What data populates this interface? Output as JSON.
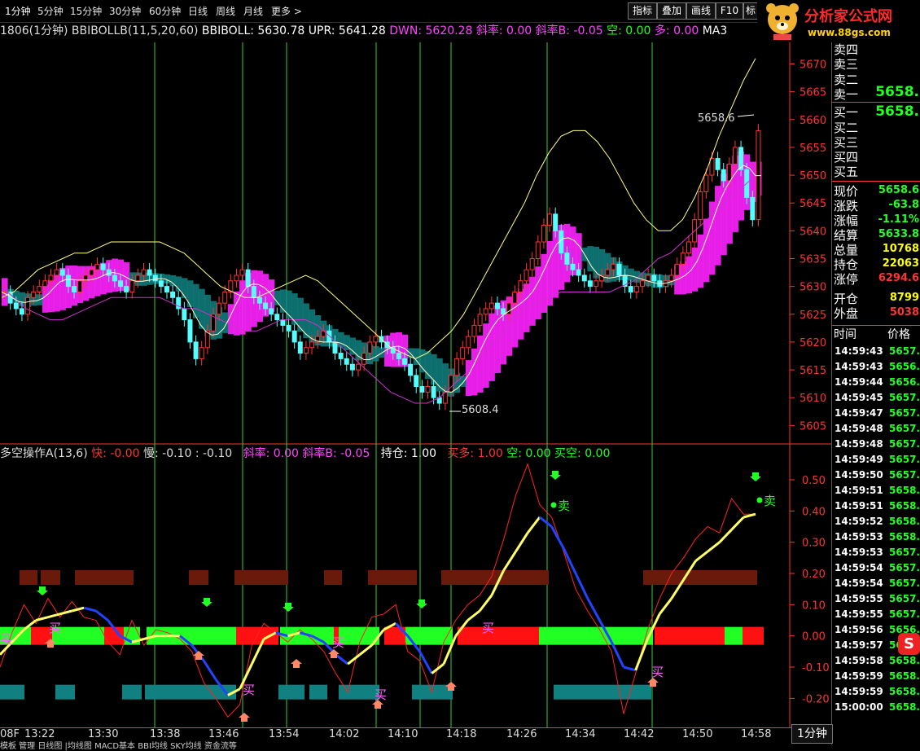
{
  "toolbar": {
    "periods": [
      "1分钟",
      "5分钟",
      "15分钟",
      "30分钟",
      "60分钟",
      "日线",
      "周线",
      "月线",
      "更多 >"
    ],
    "right_buttons": [
      "指标",
      "叠加",
      "画线",
      "F10",
      "标"
    ]
  },
  "logo": {
    "title": "分析家公式网",
    "url": "www.88gs.com"
  },
  "main_header": {
    "symbol": "1806(1分钟)",
    "indicator": "BBIBOLLB(11,5,20,60)",
    "bbiboll": "BBIBOLL: 5630.78",
    "upr": "UPR: 5641.28",
    "dwn": "DWN: 5620.28",
    "slope": "斜率: 0.00",
    "slope_b": "斜率B: -0.05",
    "kong": "空: 0.00",
    "duo": "多: 0.00",
    "ma": "MA3"
  },
  "sub_header": {
    "name": "多空操作A(13,6)",
    "fast": "快: -0.00",
    "slow": "慢: -0.10",
    "diff": ": -0.10",
    "slope": "斜率: 0.00",
    "slope_b": "斜率B: -0.05",
    "hold": "持仓: 1.00",
    "buy_long": "买多: 1.00",
    "kong": "空: 0.00",
    "buy_short": "买空: 0.00"
  },
  "price_axis": [
    "5670",
    "5665",
    "5660",
    "5655",
    "5650",
    "5645",
    "5640",
    "5635",
    "5630",
    "5625",
    "5620",
    "5615",
    "5610",
    "5605"
  ],
  "osc_axis": [
    "0.50",
    "0.40",
    "0.30",
    "0.20",
    "0.10",
    "0.00",
    "-0.10",
    "-0.20"
  ],
  "time_axis": [
    "08F",
    "13:22",
    "13:30",
    "13:38",
    "13:46",
    "13:54",
    "14:02",
    "14:10",
    "14:18",
    "14:26",
    "14:34",
    "14:42",
    "14:50",
    "14:58"
  ],
  "timeframe_button": "1分钟",
  "bottom_tabs": "模板 管理 日线图 |均线图 MACD基本 BBI均线 SKY均线 资金流等",
  "annotations": {
    "high": "5658.6",
    "low": "5608.4",
    "sell": "卖",
    "buy": "买"
  },
  "quote_panel": {
    "asks": [
      "卖四",
      "卖三",
      "卖二",
      "卖一"
    ],
    "ask1_price": "5658.",
    "bids": [
      "买一",
      "买二",
      "买三",
      "买四",
      "买五"
    ],
    "bid1_price": "5658.",
    "stats": [
      {
        "label": "现价",
        "value": "5658.6",
        "color": "#22ff22"
      },
      {
        "label": "涨跌",
        "value": "-63.8",
        "color": "#22ff22"
      },
      {
        "label": "涨幅",
        "value": "-1.11%",
        "color": "#22ff22"
      },
      {
        "label": "结算",
        "value": "5633.8",
        "color": "#22ff22"
      },
      {
        "label": "总量",
        "value": "10768",
        "color": "#ffff00"
      },
      {
        "label": "持仓",
        "value": "22063",
        "color": "#ffff00"
      },
      {
        "label": "涨停",
        "value": "6294.6",
        "color": "#ff3333"
      },
      {
        "label": "开仓",
        "value": "8799",
        "color": "#ffff00"
      },
      {
        "label": "外盘",
        "value": "5038",
        "color": "#ff3333"
      }
    ],
    "tick_header": {
      "time": "时间",
      "price": "价格"
    },
    "ticks": [
      {
        "t": "14:59:43",
        "p": "5657."
      },
      {
        "t": "14:59:43",
        "p": "5656."
      },
      {
        "t": "14:59:44",
        "p": "5656."
      },
      {
        "t": "14:59:45",
        "p": "5657."
      },
      {
        "t": "14:59:47",
        "p": "5657."
      },
      {
        "t": "14:59:48",
        "p": "5657."
      },
      {
        "t": "14:59:48",
        "p": "5657."
      },
      {
        "t": "14:59:49",
        "p": "5657."
      },
      {
        "t": "14:59:50",
        "p": "5657."
      },
      {
        "t": "14:59:51",
        "p": "5658."
      },
      {
        "t": "14:59:51",
        "p": "5658."
      },
      {
        "t": "14:59:52",
        "p": "5658."
      },
      {
        "t": "14:59:53",
        "p": "5658."
      },
      {
        "t": "14:59:53",
        "p": "5657."
      },
      {
        "t": "14:59:54",
        "p": "5657."
      },
      {
        "t": "14:59:54",
        "p": "5657."
      },
      {
        "t": "14:59:55",
        "p": "5657."
      },
      {
        "t": "14:59:55",
        "p": "5657."
      },
      {
        "t": "14:59:56",
        "p": "5656."
      },
      {
        "t": "14:59:57",
        "p": "5656."
      },
      {
        "t": "14:59:58",
        "p": "5658."
      },
      {
        "t": "14:59:59",
        "p": "5658."
      },
      {
        "t": "14:59:59",
        "p": "5658."
      },
      {
        "t": "15:00:00",
        "p": "5658."
      }
    ]
  },
  "chart_data": [
    {
      "type": "candlestick",
      "panel": "price",
      "yrange": [
        5603,
        5673
      ],
      "close": [
        5629,
        5627,
        5626,
        5625,
        5628,
        5629,
        5630,
        5631,
        5632,
        5633,
        5632,
        5630,
        5629,
        5631,
        5632,
        5633,
        5634,
        5633,
        5632,
        5631,
        5630,
        5629,
        5631,
        5632,
        5633,
        5632,
        5631,
        5630,
        5629,
        5628,
        5626,
        5624,
        5620,
        5617,
        5619,
        5622,
        5625,
        5627,
        5629,
        5631,
        5632,
        5633,
        5630,
        5628,
        5627,
        5626,
        5625,
        5624,
        5623,
        5622,
        5620,
        5618,
        5619,
        5620,
        5621,
        5622,
        5620,
        5618,
        5617,
        5616,
        5615,
        5616,
        5618,
        5620,
        5621,
        5620,
        5619,
        5618,
        5617,
        5616,
        5614,
        5612,
        5611,
        5612,
        5610,
        5609,
        5611,
        5614,
        5617,
        5619,
        5621,
        5623,
        5625,
        5626,
        5627,
        5626,
        5625,
        5627,
        5629,
        5631,
        5633,
        5635,
        5638,
        5641,
        5643,
        5640,
        5636,
        5634,
        5633,
        5632,
        5631,
        5630,
        5631,
        5632,
        5633,
        5634,
        5632,
        5630,
        5629,
        5630,
        5631,
        5632,
        5631,
        5630,
        5631,
        5632,
        5634,
        5636,
        5638,
        5642,
        5647,
        5650,
        5653,
        5651,
        5649,
        5652,
        5655,
        5651,
        5646,
        5642,
        5658
      ],
      "upper": [
        5628,
        5629,
        5631,
        5633,
        5634,
        5635,
        5636,
        5636,
        5637,
        5638,
        5638,
        5638,
        5638,
        5638,
        5637,
        5636,
        5634,
        5632,
        5630,
        5629,
        5628,
        5628,
        5629,
        5630,
        5631,
        5632,
        5631,
        5629,
        5627,
        5625,
        5623,
        5621,
        5619,
        5618,
        5617,
        5618,
        5620,
        5622,
        5625,
        5629,
        5633,
        5637,
        5641,
        5645,
        5650,
        5654,
        5657,
        5658,
        5658,
        5656,
        5653,
        5649,
        5645,
        5642,
        5640,
        5640,
        5642,
        5646,
        5651,
        5657,
        5662,
        5667,
        5671
      ],
      "lower": [
        5630,
        5628,
        5626,
        5625,
        5624,
        5624,
        5625,
        5626,
        5627,
        5628,
        5628,
        5628,
        5628,
        5628,
        5627,
        5626,
        5626,
        5625,
        5624,
        5623,
        5622,
        5622,
        5623,
        5624,
        5624,
        5624,
        5623,
        5621,
        5619,
        5617,
        5615,
        5613,
        5611,
        5610,
        5609,
        5609,
        5610,
        5612,
        5614,
        5616,
        5619,
        5621,
        5624,
        5626,
        5627,
        5628,
        5629,
        5629,
        5629,
        5629,
        5629,
        5630,
        5631,
        5633,
        5635,
        5636,
        5638,
        5640,
        5642,
        5644,
        5646,
        5648,
        5650
      ]
    },
    {
      "type": "line",
      "panel": "oscillator",
      "yrange": [
        -0.28,
        0.56
      ],
      "series": [
        {
          "values": [
            -0.06,
            -0.02,
            0.02,
            0.05,
            0.06,
            0.07,
            0.08,
            0.09,
            0.08,
            0.05,
            0.0,
            -0.02,
            -0.01,
            0.0,
            0.0,
            0.0,
            -0.03,
            -0.08,
            -0.14,
            -0.19,
            -0.17,
            -0.09,
            -0.01,
            0.01,
            0.0,
            0.01,
            0.0,
            -0.02,
            -0.06,
            -0.09,
            -0.06,
            -0.03,
            0.02,
            0.04,
            0.0,
            -0.05,
            -0.12,
            -0.09,
            0.0,
            0.05,
            0.08,
            0.13,
            0.21,
            0.27,
            0.33,
            0.38,
            0.35,
            0.28,
            0.2,
            0.12,
            0.05,
            -0.02,
            -0.1,
            -0.11,
            -0.01,
            0.07,
            0.12,
            0.18,
            0.24,
            0.27,
            0.3,
            0.34,
            0.38,
            0.39
          ]
        },
        {
          "values": [
            -0.1,
            0.01,
            0.1,
            0.04,
            0.12,
            0.06,
            0.11,
            0.06,
            0.05,
            -0.02,
            -0.06,
            0.05,
            -0.03,
            0.02,
            0.01,
            -0.01,
            -0.05,
            -0.15,
            -0.2,
            -0.26,
            -0.22,
            -0.03,
            0.04,
            0.01,
            -0.02,
            0.02,
            -0.01,
            -0.05,
            -0.12,
            -0.18,
            -0.02,
            0.06,
            0.07,
            0.1,
            -0.05,
            -0.08,
            -0.18,
            -0.02,
            0.05,
            0.1,
            0.13,
            0.19,
            0.31,
            0.45,
            0.55,
            0.42,
            0.38,
            0.27,
            0.15,
            0.08,
            0.02,
            -0.05,
            -0.25,
            -0.12,
            0.02,
            0.12,
            0.2,
            0.25,
            0.31,
            0.35,
            0.33,
            0.44,
            0.39,
            0.39
          ]
        }
      ]
    }
  ]
}
